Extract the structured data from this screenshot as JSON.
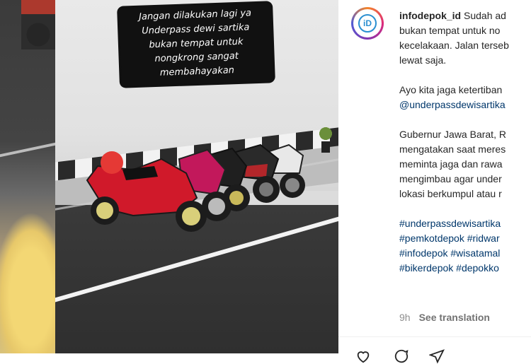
{
  "photo": {
    "caption_lines": [
      "Jangan dilakukan lagi ya",
      "Underpass dewi sartika",
      "bukan tempat untuk",
      "nongkrong sangat",
      "membahayakan"
    ]
  },
  "post": {
    "avatar_logo": "iD",
    "username": "infodepok_id",
    "caption_lines": [
      "Sudah ad",
      "bukan tempat untuk no",
      "kecelakaan. Jalan terseb",
      "lewat saja."
    ],
    "para2_lines": [
      "Ayo kita jaga ketertiban"
    ],
    "mention": "@underpassdewisartika",
    "para3_lines": [
      "Gubernur Jawa Barat, R",
      "mengatakan saat meres",
      "meminta jaga dan rawa",
      "mengimbau agar under",
      "lokasi berkumpul atau r"
    ],
    "hashtag_lines": [
      "#underpassdewisartika",
      "#pemkotdepok #ridwar",
      "#infodepok #wisatamal",
      "#bikerdepok #depokko"
    ],
    "time": "9h",
    "translate": "See translation"
  },
  "icons": {
    "like": "heart-icon",
    "comment": "comment-icon",
    "share": "share-icon"
  }
}
